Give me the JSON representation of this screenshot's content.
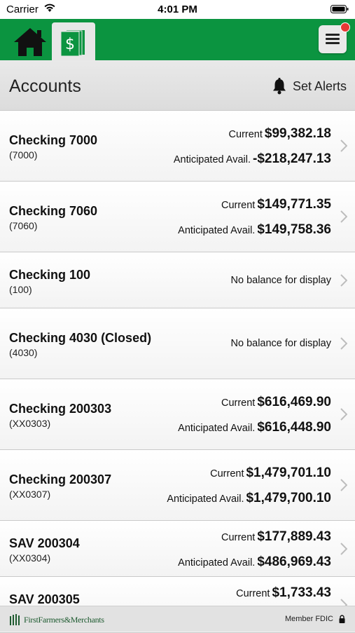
{
  "status_bar": {
    "carrier": "Carrier",
    "time": "4:01 PM"
  },
  "nav": {
    "home_icon": "home-icon",
    "accounts_icon": "dollar-bill-icon",
    "menu_icon": "hamburger-menu-icon",
    "accent": "#0b9440",
    "notification_color": "#e53935"
  },
  "header": {
    "title": "Accounts",
    "alerts_label": "Set Alerts",
    "alerts_icon": "bell-icon"
  },
  "accounts": [
    {
      "name": "Checking 7000",
      "number": "(7000)",
      "current_label": "Current",
      "current": "$99,382.18",
      "avail_label": "Anticipated Avail.",
      "avail": "-$218,247.13"
    },
    {
      "name": "Checking 7060",
      "number": "(7060)",
      "current_label": "Current",
      "current": "$149,771.35",
      "avail_label": "Anticipated Avail.",
      "avail": "$149,758.36"
    },
    {
      "name": "Checking 100",
      "number": "(100)",
      "no_balance": "No balance for display"
    },
    {
      "name": "Checking 4030 (Closed)",
      "number": "(4030)",
      "no_balance": "No balance for display"
    },
    {
      "name": "Checking 200303",
      "number": "(XX0303)",
      "current_label": "Current",
      "current": "$616,469.90",
      "avail_label": "Anticipated Avail.",
      "avail": "$616,448.90"
    },
    {
      "name": "Checking 200307",
      "number": "(XX0307)",
      "current_label": "Current",
      "current": "$1,479,701.10",
      "avail_label": "Anticipated Avail.",
      "avail": "$1,479,700.10"
    },
    {
      "name": "SAV 200304",
      "number": "(XX0304)",
      "current_label": "Current",
      "current": "$177,889.43",
      "avail_label": "Anticipated Avail.",
      "avail": "$486,969.43"
    },
    {
      "name": "SAV 200305",
      "current_label": "Current",
      "current": "$1,733.43"
    }
  ],
  "footer": {
    "logo_text": "FirstFarmers&Merchants",
    "member": "Member FDIC",
    "lock_icon": "lock-icon"
  }
}
